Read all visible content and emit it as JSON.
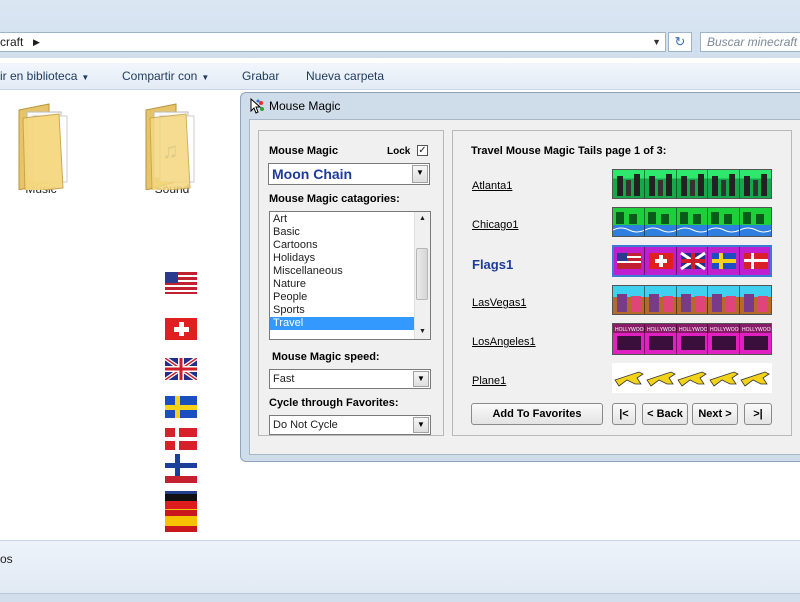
{
  "explorer": {
    "address_text": "craft",
    "search_placeholder": "Buscar minecraft",
    "toolbar": [
      "ir en biblioteca",
      "Compartir con",
      "Grabar",
      "Nueva carpeta"
    ],
    "folders": [
      {
        "name": "Music"
      },
      {
        "name": "Sound"
      }
    ],
    "status_text": "os",
    "flag_icons": [
      "usa-flag-icon",
      "swiss-flag-icon",
      "uk-flag-icon",
      "sweden-flag-icon",
      "denmark-flag-icon",
      "finland-flag-icon",
      "netherlands-flag-icon",
      "germany-flag-icon",
      "spain-flag-icon"
    ]
  },
  "window": {
    "title": "Mouse Magic"
  },
  "left_panel": {
    "mm_label": "Mouse Magic",
    "lock_label": "Lock",
    "lock_checked": true,
    "mm_selected": "Moon Chain",
    "categories_label": "Mouse Magic catagories:",
    "categories": [
      "Art",
      "Basic",
      "Cartoons",
      "Holidays",
      "Miscellaneous",
      "Nature",
      "People",
      "Sports",
      "Travel"
    ],
    "selected_category": "Travel",
    "speed_label": "Mouse Magic speed:",
    "speed_value": "Fast",
    "cycle_label": "Cycle through Favorites:",
    "cycle_value": "Do Not Cycle"
  },
  "right_panel": {
    "header": "Travel Mouse Magic Tails page 1 of 3:",
    "tails": [
      {
        "name": "Atlanta1",
        "style": "atlanta"
      },
      {
        "name": "Chicago1",
        "style": "chicago"
      },
      {
        "name": "Flags1",
        "style": "flags",
        "selected": true
      },
      {
        "name": "LasVegas1",
        "style": "lasvegas"
      },
      {
        "name": "LosAngeles1",
        "style": "losangeles"
      },
      {
        "name": "Plane1",
        "style": "plane"
      }
    ],
    "add_favorites": "Add To Favorites",
    "nav_first": "|<",
    "nav_back": "< Back",
    "nav_next": "Next >",
    "nav_last": ">|"
  },
  "colors": {
    "selection": "#3399ff",
    "selected_tail_text": "#1f3b99",
    "accent_blue": "#3a7bd5"
  }
}
